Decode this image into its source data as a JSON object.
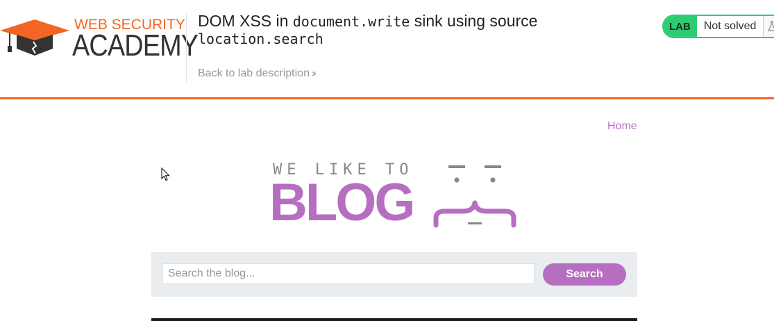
{
  "header": {
    "logo": {
      "line1": "WEB SECURITY",
      "line2": "ACADEMY",
      "icon": "graduation-cap-icon",
      "brand_orange": "#f26522",
      "brand_dark": "#333332"
    },
    "lab_title_prefix": "DOM XSS in ",
    "lab_title_code1": "document.write",
    "lab_title_middle": " sink using source",
    "lab_title_code2": "location.search",
    "back_link": "Back to lab description",
    "back_link_icon": "double-chevron-right-icon",
    "status": {
      "badge": "LAB",
      "text": "Not solved",
      "icon": "flask-icon",
      "color": "#2ecc71"
    },
    "rule_color": "#f26522"
  },
  "nav": {
    "home": "Home"
  },
  "blog": {
    "tagline": "WE LIKE TO",
    "title": "BLOG",
    "face_icon": "curly-brace-face-icon",
    "accent": "#b66fc0"
  },
  "search": {
    "placeholder": "Search the blog...",
    "value": "",
    "button": "Search"
  }
}
